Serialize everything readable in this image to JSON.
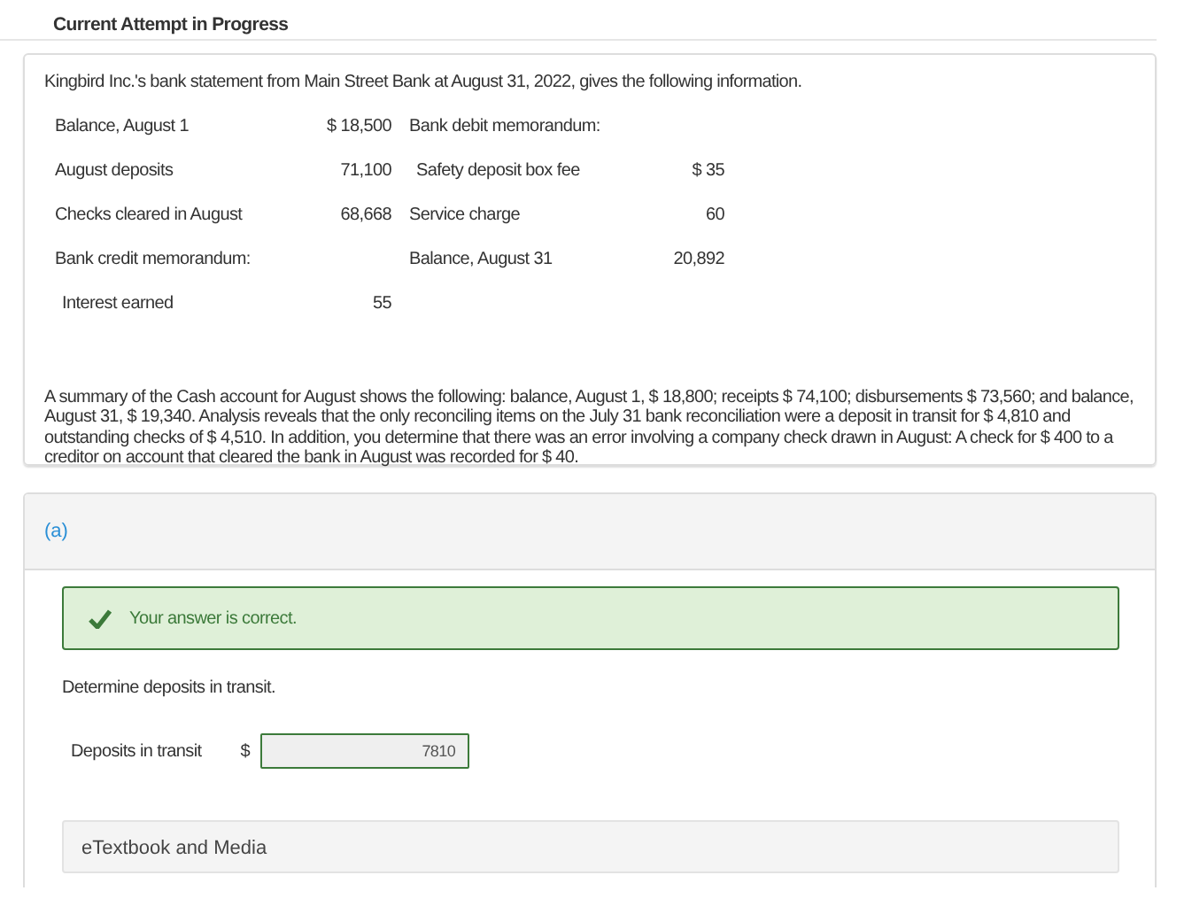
{
  "heading": "Current Attempt in Progress",
  "problem": {
    "intro": "Kingbird Inc.'s bank statement from Main Street Bank at August 31, 2022, gives the following information.",
    "statement_left": [
      {
        "kind": "item",
        "label": "Balance, August 1",
        "amount": "$ 18,500"
      },
      {
        "kind": "item",
        "label": "August deposits",
        "amount": "71,100"
      },
      {
        "kind": "item",
        "label": "Checks cleared in August",
        "amount": "68,668"
      },
      {
        "kind": "heading",
        "label": "Bank credit memorandum:"
      },
      {
        "kind": "sub-item",
        "label": "Interest earned",
        "amount": "55"
      }
    ],
    "statement_right": [
      {
        "kind": "heading",
        "label": "Bank debit memorandum:"
      },
      {
        "kind": "sub-item",
        "label": "Safety deposit box fee",
        "amount": "$ 35"
      },
      {
        "kind": "item",
        "label": "Service charge",
        "amount": "60"
      },
      {
        "kind": "item",
        "label": "Balance, August 31",
        "amount": "20,892"
      }
    ],
    "summary": "A summary of the Cash account for August shows the following: balance, August 1, $ 18,800; receipts $ 74,100; disbursements $ 73,560; and balance, August 31, $ 19,340. Analysis reveals that the only reconciling items on the July 31 bank reconciliation were a deposit in transit for $ 4,810 and outstanding checks of $ 4,510. In addition, you determine that there was an error involving a company check drawn in August: A check for $ 400 to a creditor on account that cleared the bank in August was recorded for $ 40."
  },
  "part": {
    "label": "(a)",
    "feedback": {
      "correct": true,
      "message": "Your answer is correct."
    },
    "question": "Determine deposits in transit.",
    "answer": {
      "label": "Deposits in transit",
      "currency": "$",
      "value": "7810"
    },
    "resources": "eTextbook and Media"
  }
}
